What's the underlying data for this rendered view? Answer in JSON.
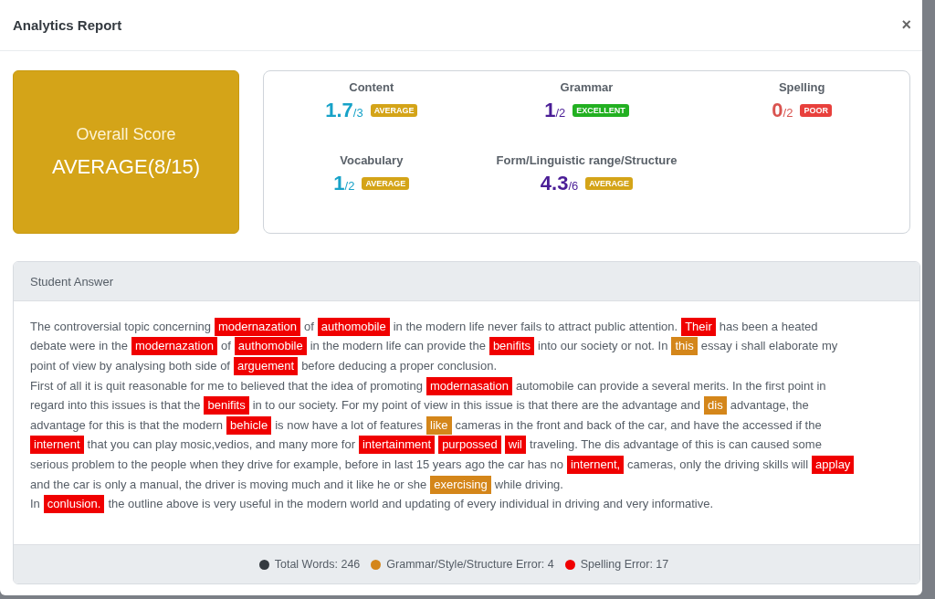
{
  "modal": {
    "title": "Analytics Report",
    "close": "×"
  },
  "overall": {
    "label": "Overall Score",
    "value": "AVERAGE(8/15)"
  },
  "scores": [
    {
      "name": "Content",
      "value": "1.7",
      "max": "/3",
      "color": "#17a2c8",
      "badge": {
        "text": "AVERAGE",
        "kind": "average"
      }
    },
    {
      "name": "Grammar",
      "value": "1",
      "max": "/2",
      "color": "#4a1d96",
      "badge": {
        "text": "EXCELLENT",
        "kind": "excellent"
      }
    },
    {
      "name": "Spelling",
      "value": "0",
      "max": "/2",
      "color": "#d9534f",
      "badge": {
        "text": "POOR",
        "kind": "poor"
      }
    },
    {
      "name": "Vocabulary",
      "value": "1",
      "max": "/2",
      "color": "#17a2c8",
      "badge": {
        "text": "AVERAGE",
        "kind": "average"
      }
    },
    {
      "name": "Form/Linguistic range/Structure",
      "value": "4.3",
      "max": "/6",
      "color": "#4a1d96",
      "badge": {
        "text": "AVERAGE",
        "kind": "average"
      }
    }
  ],
  "answer": {
    "title": "Student Answer",
    "lines": [
      [
        {
          "text": "The controversial topic concerning",
          "kind": "plain"
        },
        {
          "text": "modernazation",
          "kind": "spelling"
        },
        {
          "text": "of",
          "kind": "plain"
        },
        {
          "text": "authomobile",
          "kind": "spelling"
        },
        {
          "text": "in the modern life never fails to attract public attention.",
          "kind": "plain"
        },
        {
          "text": "Their",
          "kind": "spelling"
        },
        {
          "text": "has been a heated",
          "kind": "plain"
        }
      ],
      [
        {
          "text": "debate were in the",
          "kind": "plain"
        },
        {
          "text": "modernazation",
          "kind": "spelling"
        },
        {
          "text": "of",
          "kind": "plain"
        },
        {
          "text": "authomobile",
          "kind": "spelling"
        },
        {
          "text": "in the modern life can provide the",
          "kind": "plain"
        },
        {
          "text": "benifits",
          "kind": "spelling"
        },
        {
          "text": "into our society or not. In",
          "kind": "plain"
        },
        {
          "text": "this",
          "kind": "grammar"
        },
        {
          "text": "essay i shall elaborate my",
          "kind": "plain"
        }
      ],
      [
        {
          "text": "point of view by analysing both side of",
          "kind": "plain"
        },
        {
          "text": "arguement",
          "kind": "spelling"
        },
        {
          "text": "before deducing a proper conclusion.",
          "kind": "plain"
        }
      ],
      [
        {
          "text": "First of all it is quit reasonable for me to believed that the idea of promoting",
          "kind": "plain"
        },
        {
          "text": "modernasation",
          "kind": "spelling"
        },
        {
          "text": "automobile can provide a several merits. In the first point in",
          "kind": "plain"
        }
      ],
      [
        {
          "text": "regard into this issues is that the",
          "kind": "plain"
        },
        {
          "text": "benifits",
          "kind": "spelling"
        },
        {
          "text": "in to our society. For my point of view in this issue is that there are the advantage and",
          "kind": "plain"
        },
        {
          "text": "dis",
          "kind": "grammar"
        },
        {
          "text": "advantage, the",
          "kind": "plain"
        }
      ],
      [
        {
          "text": "advantage for this is that the modern",
          "kind": "plain"
        },
        {
          "text": "behicle",
          "kind": "spelling"
        },
        {
          "text": "is now have a lot of features",
          "kind": "plain"
        },
        {
          "text": "like",
          "kind": "grammar"
        },
        {
          "text": "cameras in the front and back of the car, and have the accessed if the",
          "kind": "plain"
        }
      ],
      [
        {
          "text": "internent",
          "kind": "spelling"
        },
        {
          "text": "that you can play mosic,vedios, and many more for",
          "kind": "plain"
        },
        {
          "text": "intertainment",
          "kind": "spelling"
        },
        {
          "text": "purpossed",
          "kind": "spelling"
        },
        {
          "text": "wil",
          "kind": "spelling"
        },
        {
          "text": "traveling. The dis advantage of this is can caused some",
          "kind": "plain"
        }
      ],
      [
        {
          "text": "serious problem to the people when they drive for example, before in last 15 years ago the car has no",
          "kind": "plain"
        },
        {
          "text": "internent,",
          "kind": "spelling"
        },
        {
          "text": "cameras, only the driving skills will",
          "kind": "plain"
        },
        {
          "text": "applay",
          "kind": "spelling"
        }
      ],
      [
        {
          "text": "and the car is only a manual, the driver is moving much and it like he or she",
          "kind": "plain"
        },
        {
          "text": "exercising",
          "kind": "grammar"
        },
        {
          "text": "while driving.",
          "kind": "plain"
        }
      ],
      [
        {
          "text": "In",
          "kind": "plain"
        },
        {
          "text": "conlusion.",
          "kind": "spelling"
        },
        {
          "text": "the outline above is very useful in the modern world and updating of every individual in driving and very informative.",
          "kind": "plain"
        }
      ]
    ],
    "legend": [
      {
        "text": "Total Words: 246",
        "color": "#343a40"
      },
      {
        "text": "Grammar/Style/Structure Error: 4",
        "color": "#d4861a"
      },
      {
        "text": "Spelling Error: 17",
        "color": "#f00000"
      }
    ]
  }
}
